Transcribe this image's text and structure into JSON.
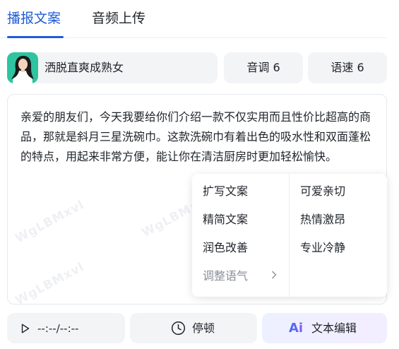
{
  "tabs": [
    {
      "label": "播报文案",
      "active": true
    },
    {
      "label": "音频上传",
      "active": false
    }
  ],
  "voice": {
    "name": "洒脱直爽成熟女",
    "avatar_icon": "woman-avatar",
    "tone_label": "音调 6",
    "speed_label": "语速 6"
  },
  "editor": {
    "text": "亲爱的朋友们，今天我要给你们介绍一款不仅实用而且性价比超高的商品，那就是斜月三星洗碗巾。这款洗碗巾有着出色的吸水性和双面蓬松的特点，用起来非常方便，能让你在清洁厨房时更加轻松愉快。",
    "watermark": "WgLBMxvl"
  },
  "menu": {
    "left_items": [
      "扩写文案",
      "精简文案",
      "润色改善",
      "调整语气"
    ],
    "submenu_chevron": "chevron-right-icon",
    "right_items": [
      "可爱亲切",
      "热情激昂",
      "专业冷静"
    ]
  },
  "bottom_bar": {
    "play_icon": "play-icon",
    "time_text": "--:--/--:--",
    "pause_icon": "clock-icon",
    "pause_label": "停顿",
    "ai_icon_text": "Ai",
    "edit_label": "文本编辑"
  },
  "colors": {
    "accent": "#1f5cd8",
    "pill_bg": "#f3f4f6",
    "avatar_bg": "#2ec4a0"
  }
}
